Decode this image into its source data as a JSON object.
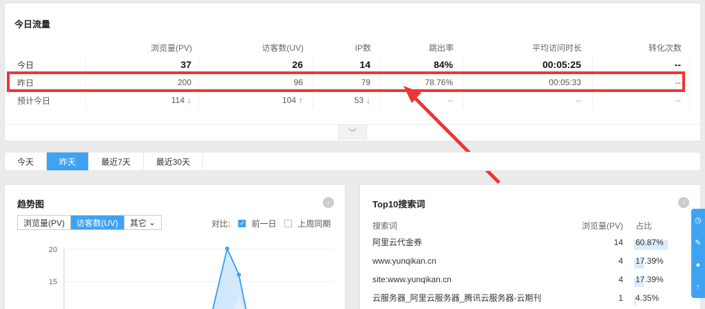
{
  "traffic": {
    "title": "今日流量",
    "headers": [
      "浏览量(PV)",
      "访客数(UV)",
      "IP数",
      "跳出率",
      "平均访问时长",
      "转化次数"
    ],
    "today": {
      "label": "今日",
      "pv": "37",
      "uv": "26",
      "ip": "14",
      "bounce": "84%",
      "avg": "00:05:25",
      "conv": "--"
    },
    "yesterday": {
      "label": "昨日",
      "pv": "200",
      "uv": "96",
      "ip": "79",
      "bounce": "78.76%",
      "avg": "00:05:33",
      "conv": "--"
    },
    "forecast": {
      "label": "预计今日",
      "pv": "114",
      "uv": "104",
      "ip": "53",
      "bounce": "--",
      "avg": "--",
      "conv": "--"
    },
    "expand_icon": "double-chevron-down-icon"
  },
  "tabs": [
    "今天",
    "昨天",
    "最近7天",
    "最近30天"
  ],
  "active_tab": "昨天",
  "trend": {
    "title": "趋势图",
    "metrics": [
      "浏览量(PV)",
      "访客数(UV)",
      "其它"
    ],
    "active_metric": "访客数(UV)",
    "compare_label": "对比:",
    "compare_options": [
      {
        "label": "前一日",
        "checked": true
      },
      {
        "label": "上周同期",
        "checked": false
      }
    ],
    "y_ticks": [
      "20",
      "15"
    ]
  },
  "top10": {
    "title": "Top10搜索词",
    "headers": [
      "搜索词",
      "浏览量(PV)",
      "占比"
    ],
    "rows": [
      {
        "keyword": "阿里云代金券",
        "pv": "14",
        "pct": "60.87%",
        "share": 0.6087
      },
      {
        "keyword": "www.yunqikan.cn",
        "pv": "4",
        "pct": "17.39%",
        "share": 0.1739
      },
      {
        "keyword": "site:www.yunqikan.cn",
        "pv": "4",
        "pct": "17.39%",
        "share": 0.1739
      },
      {
        "keyword": "云服务器_阿里云服务器_腾讯云服务器-云期刊",
        "pv": "1",
        "pct": "4.35%",
        "share": 0.0435
      }
    ]
  },
  "colors": {
    "accent": "#3fa3f4",
    "highlight": "#ee3535",
    "up": "#e74c3c",
    "down": "#3cb44b"
  }
}
